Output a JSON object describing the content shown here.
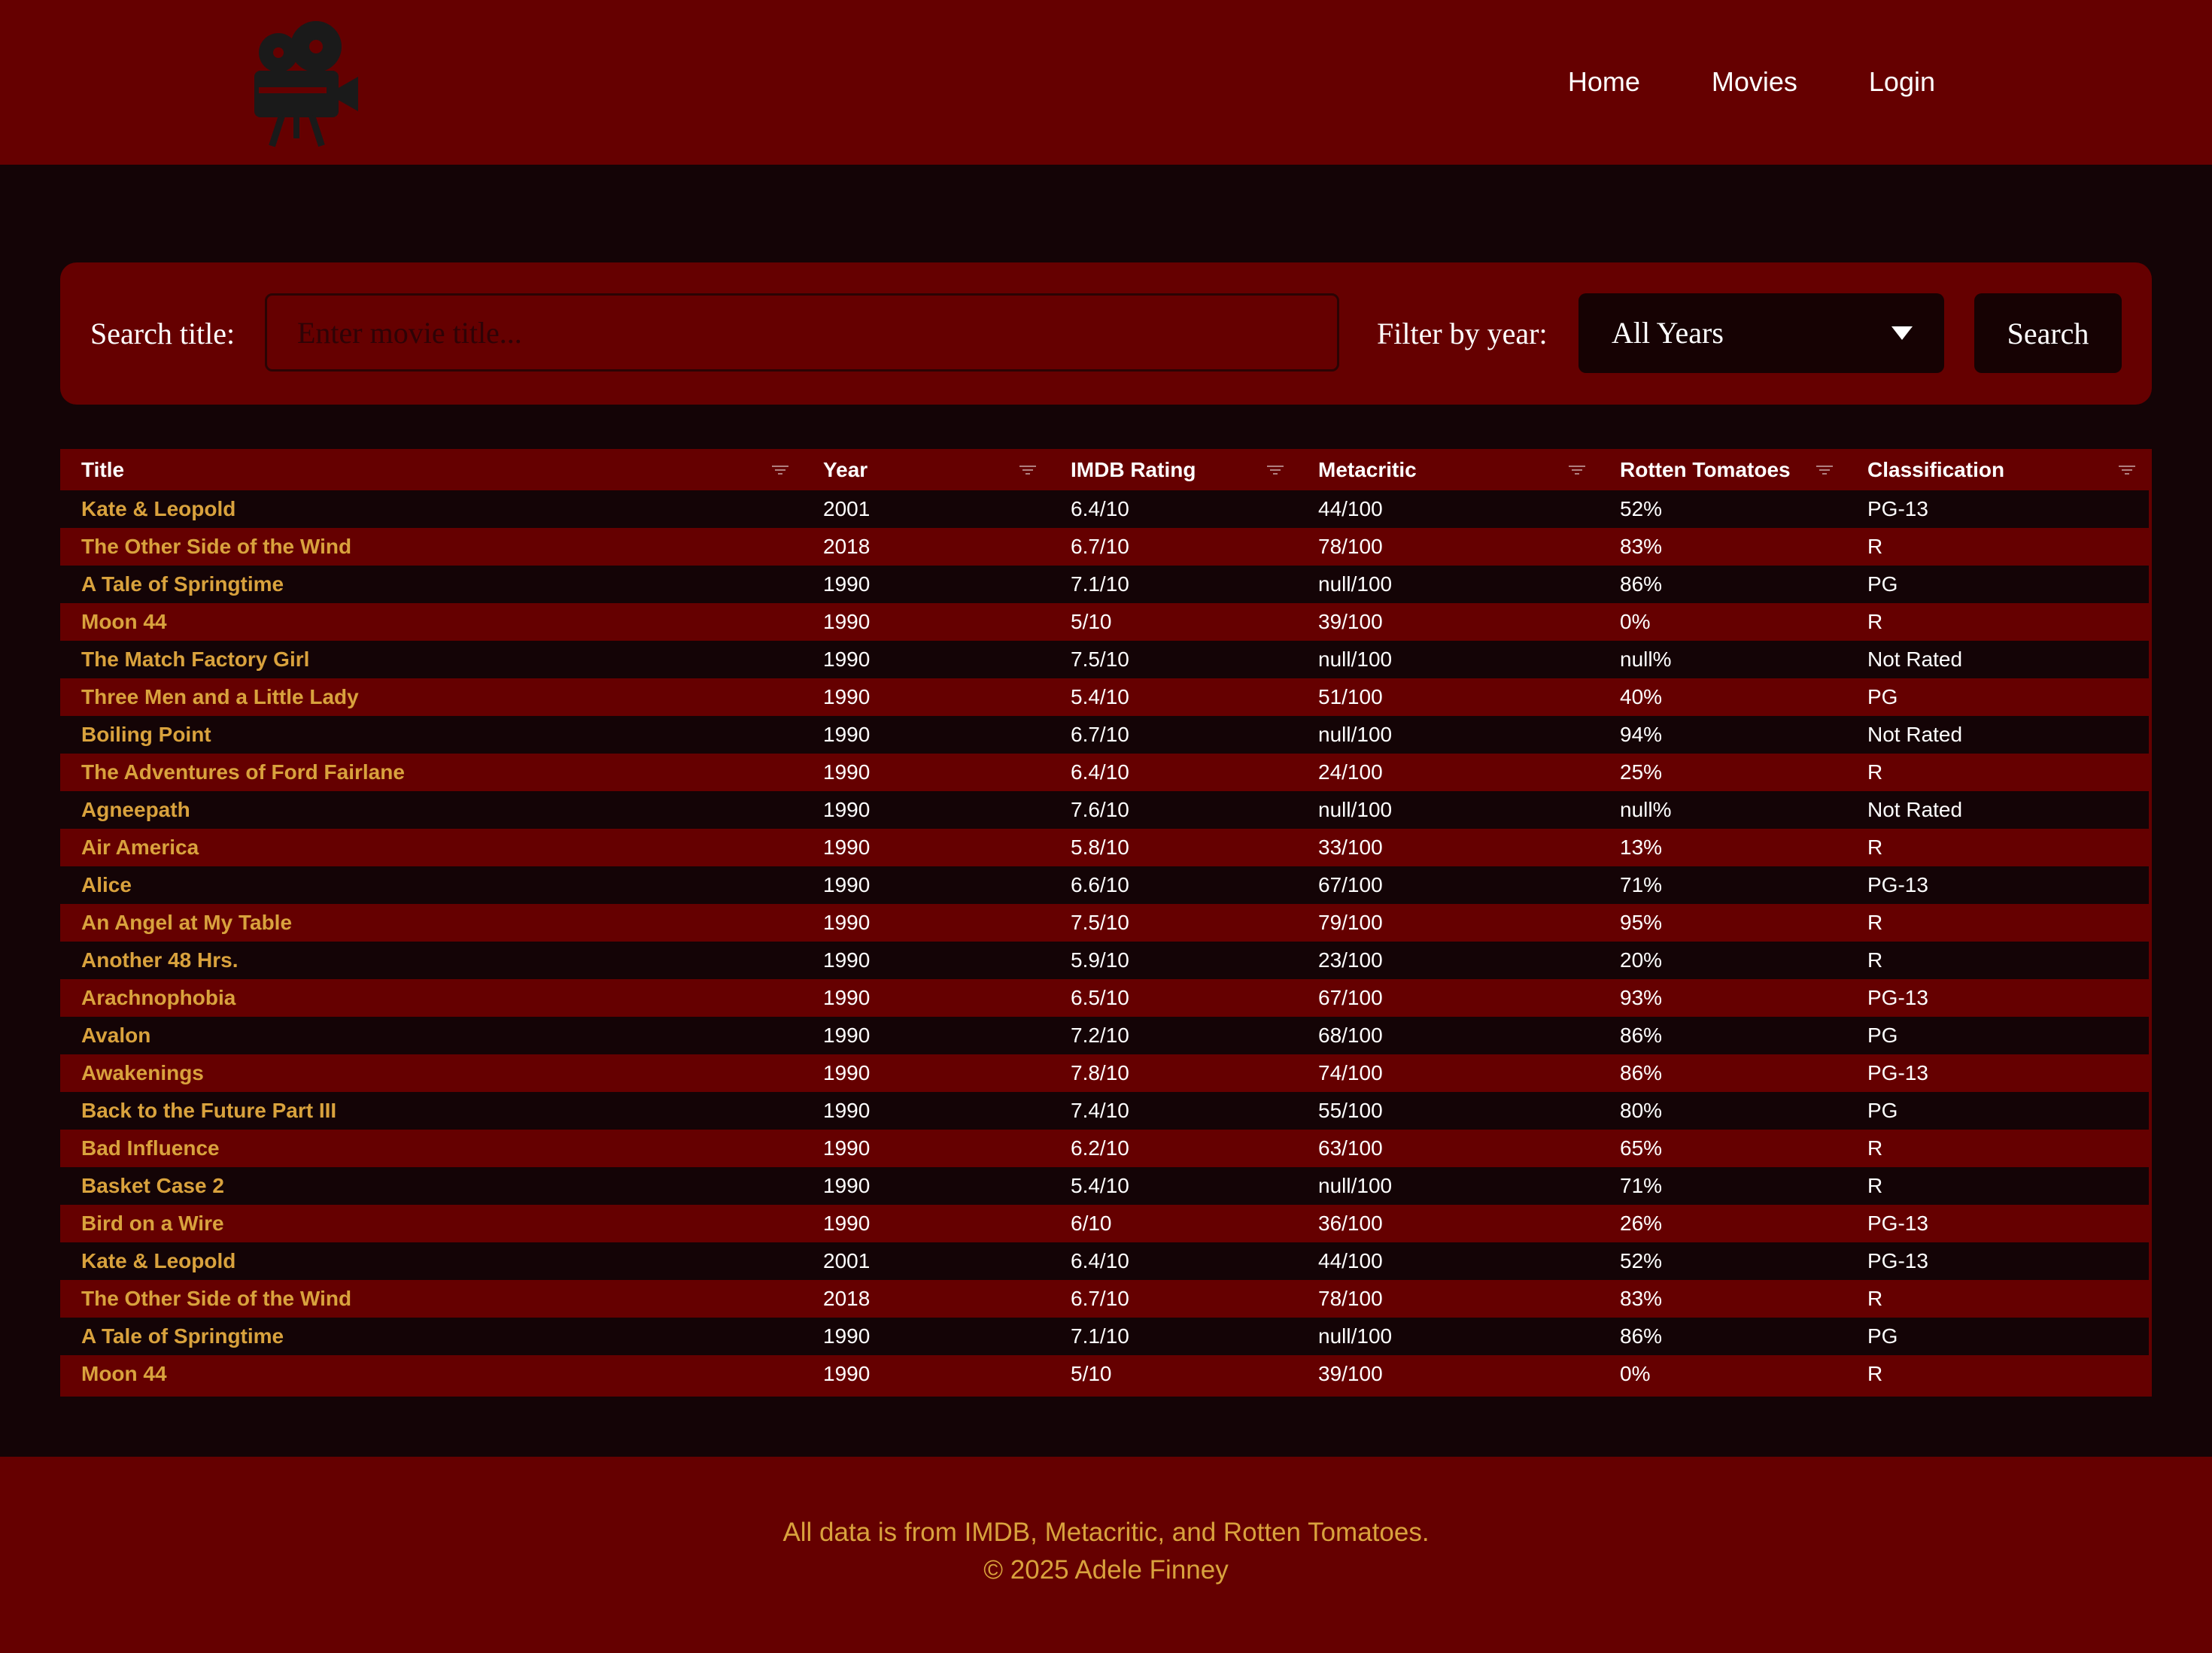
{
  "nav": {
    "items": [
      "Home",
      "Movies",
      "Login"
    ]
  },
  "search": {
    "title_label": "Search title:",
    "title_placeholder": "Enter movie title...",
    "year_label": "Filter by year:",
    "year_selected": "All Years",
    "button_label": "Search"
  },
  "table": {
    "columns": [
      "Title",
      "Year",
      "IMDB Rating",
      "Metacritic",
      "Rotten Tomatoes",
      "Classification"
    ],
    "rows": [
      [
        "Kate & Leopold",
        "2001",
        "6.4/10",
        "44/100",
        "52%",
        "PG-13"
      ],
      [
        "The Other Side of the Wind",
        "2018",
        "6.7/10",
        "78/100",
        "83%",
        "R"
      ],
      [
        "A Tale of Springtime",
        "1990",
        "7.1/10",
        "null/100",
        "86%",
        "PG"
      ],
      [
        "Moon 44",
        "1990",
        "5/10",
        "39/100",
        "0%",
        "R"
      ],
      [
        "The Match Factory Girl",
        "1990",
        "7.5/10",
        "null/100",
        "null%",
        "Not Rated"
      ],
      [
        "Three Men and a Little Lady",
        "1990",
        "5.4/10",
        "51/100",
        "40%",
        "PG"
      ],
      [
        "Boiling Point",
        "1990",
        "6.7/10",
        "null/100",
        "94%",
        "Not Rated"
      ],
      [
        "The Adventures of Ford Fairlane",
        "1990",
        "6.4/10",
        "24/100",
        "25%",
        "R"
      ],
      [
        "Agneepath",
        "1990",
        "7.6/10",
        "null/100",
        "null%",
        "Not Rated"
      ],
      [
        "Air America",
        "1990",
        "5.8/10",
        "33/100",
        "13%",
        "R"
      ],
      [
        "Alice",
        "1990",
        "6.6/10",
        "67/100",
        "71%",
        "PG-13"
      ],
      [
        "An Angel at My Table",
        "1990",
        "7.5/10",
        "79/100",
        "95%",
        "R"
      ],
      [
        "Another 48 Hrs.",
        "1990",
        "5.9/10",
        "23/100",
        "20%",
        "R"
      ],
      [
        "Arachnophobia",
        "1990",
        "6.5/10",
        "67/100",
        "93%",
        "PG-13"
      ],
      [
        "Avalon",
        "1990",
        "7.2/10",
        "68/100",
        "86%",
        "PG"
      ],
      [
        "Awakenings",
        "1990",
        "7.8/10",
        "74/100",
        "86%",
        "PG-13"
      ],
      [
        "Back to the Future Part III",
        "1990",
        "7.4/10",
        "55/100",
        "80%",
        "PG"
      ],
      [
        "Bad Influence",
        "1990",
        "6.2/10",
        "63/100",
        "65%",
        "R"
      ],
      [
        "Basket Case 2",
        "1990",
        "5.4/10",
        "null/100",
        "71%",
        "R"
      ],
      [
        "Bird on a Wire",
        "1990",
        "6/10",
        "36/100",
        "26%",
        "PG-13"
      ],
      [
        "Kate & Leopold",
        "2001",
        "6.4/10",
        "44/100",
        "52%",
        "PG-13"
      ],
      [
        "The Other Side of the Wind",
        "2018",
        "6.7/10",
        "78/100",
        "83%",
        "R"
      ],
      [
        "A Tale of Springtime",
        "1990",
        "7.1/10",
        "null/100",
        "86%",
        "PG"
      ],
      [
        "Moon 44",
        "1990",
        "5/10",
        "39/100",
        "0%",
        "R"
      ]
    ]
  },
  "footer": {
    "line1": "All data is from IMDB, Metacritic, and Rotten Tomatoes.",
    "line2": "© 2025 Adele Finney"
  },
  "colors": {
    "primary_red": "#650000",
    "dark_background": "#140406",
    "title_gold": "#d9a23d"
  },
  "icons": {
    "logo": "film-camera-icon",
    "select_caret": "caret-down-icon",
    "column_filter": "filter-icon"
  }
}
